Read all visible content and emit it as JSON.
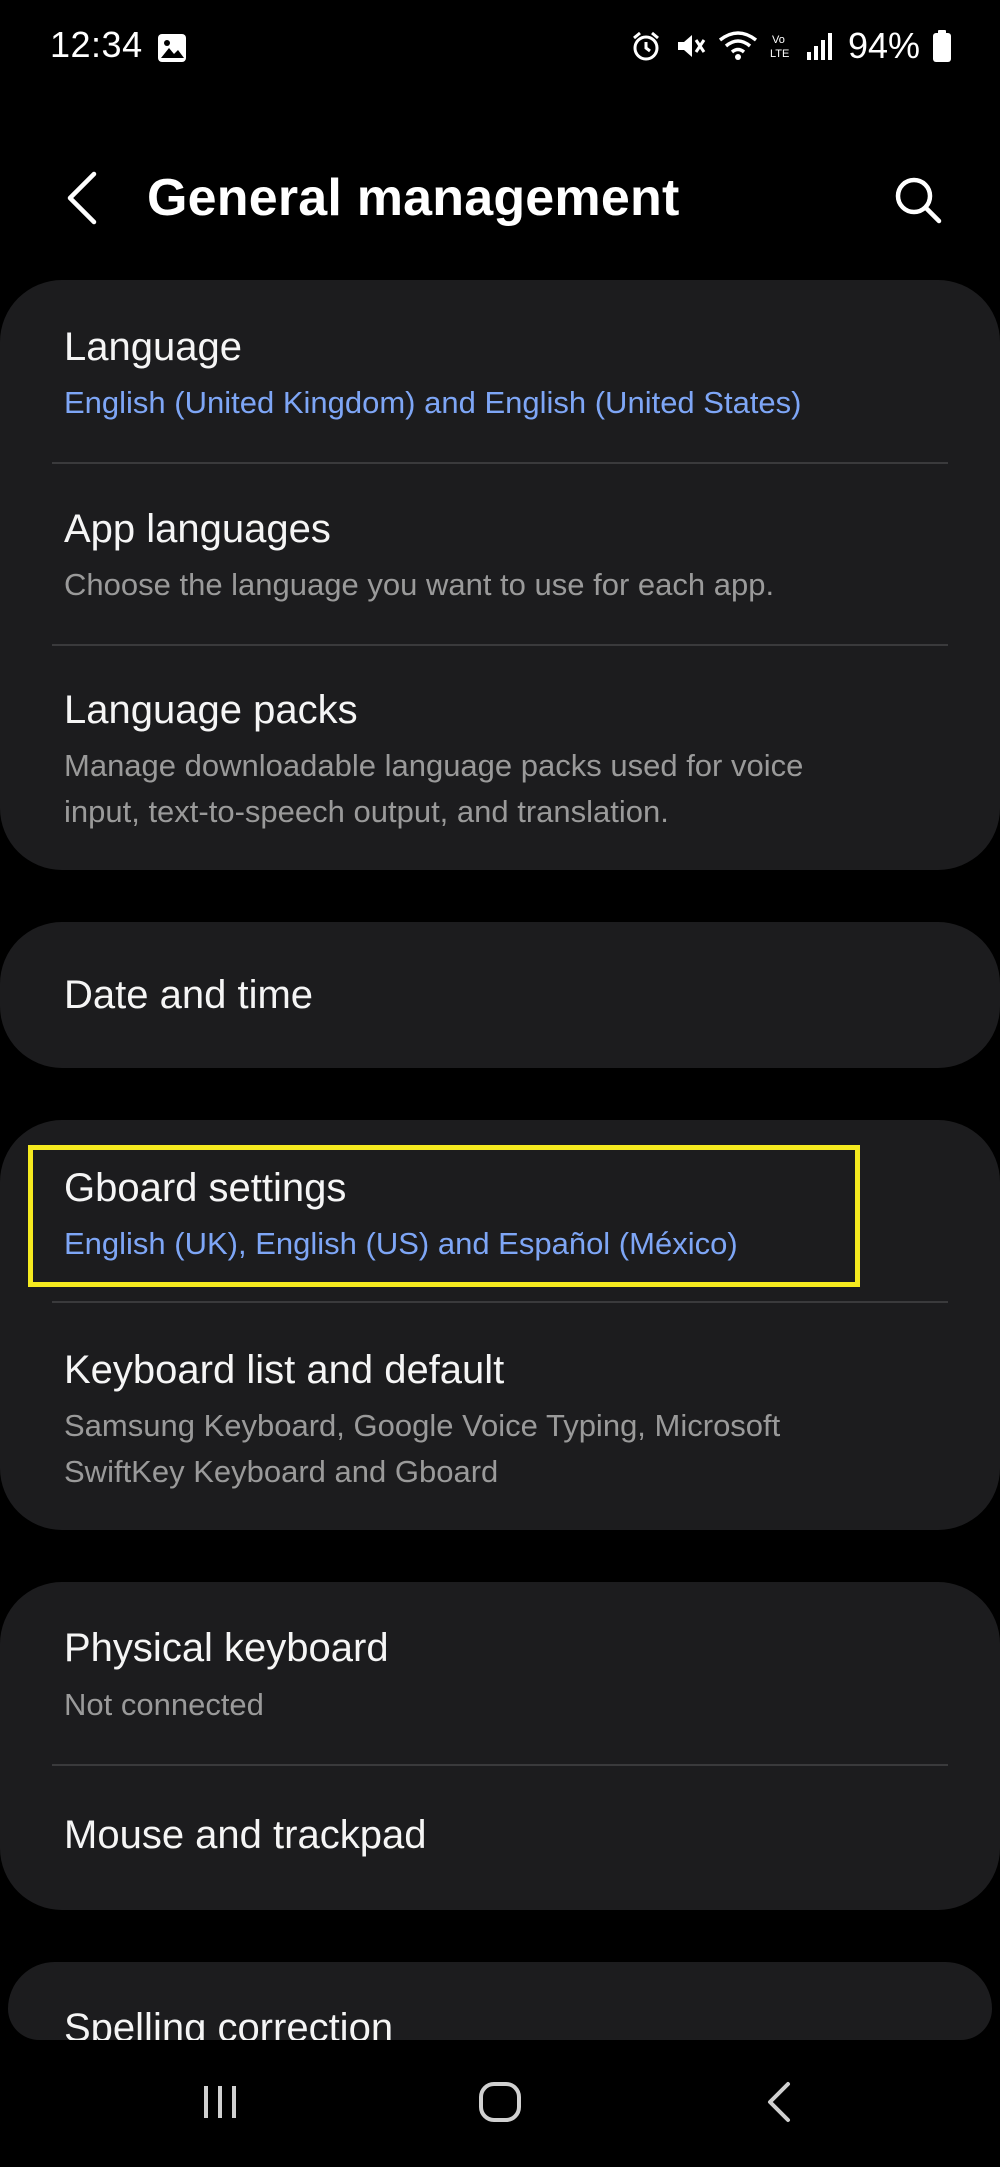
{
  "status_bar": {
    "time": "12:34",
    "battery_percent": "94%",
    "icons": [
      "gallery-icon",
      "alarm-icon",
      "mute-icon",
      "wifi-icon",
      "volte-icon",
      "signal-icon",
      "battery-icon"
    ]
  },
  "header": {
    "title": "General management",
    "back_icon": "chevron-left-icon",
    "search_icon": "search-icon"
  },
  "cards": [
    {
      "rows": [
        {
          "title": "Language",
          "subtitle": "English (United Kingdom) and English (United States)",
          "subtitle_style": "accent"
        },
        {
          "title": "App languages",
          "subtitle": "Choose the language you want to use for each app.",
          "subtitle_style": "normal"
        },
        {
          "title": "Language packs",
          "subtitle_line1": "Manage downloadable language packs used for voice",
          "subtitle_line2": "input, text-to-speech output, and translation.",
          "subtitle_style": "normal"
        }
      ]
    },
    {
      "rows": [
        {
          "title": "Date and time"
        }
      ]
    },
    {
      "rows": [
        {
          "title": "Gboard settings",
          "subtitle": "English (UK), English (US) and Español (México)",
          "subtitle_style": "accent",
          "highlighted": true
        },
        {
          "title": "Keyboard list and default",
          "subtitle_line1": "Samsung Keyboard, Google Voice Typing, Microsoft",
          "subtitle_line2": "SwiftKey Keyboard and Gboard",
          "subtitle_style": "normal"
        }
      ]
    },
    {
      "rows": [
        {
          "title": "Physical keyboard",
          "subtitle": "Not connected",
          "subtitle_style": "normal"
        },
        {
          "title": "Mouse and trackpad"
        }
      ]
    },
    {
      "rows": [
        {
          "title": "Spelling correction"
        }
      ]
    }
  ],
  "colors": {
    "background": "#000000",
    "card": "#1c1c1e",
    "accent_text": "#7ea6f6",
    "secondary_text": "#9a9a9a",
    "highlight": "#f5ea1f"
  },
  "nav_bar": {
    "buttons": [
      "recents-icon",
      "home-icon",
      "back-icon"
    ]
  }
}
